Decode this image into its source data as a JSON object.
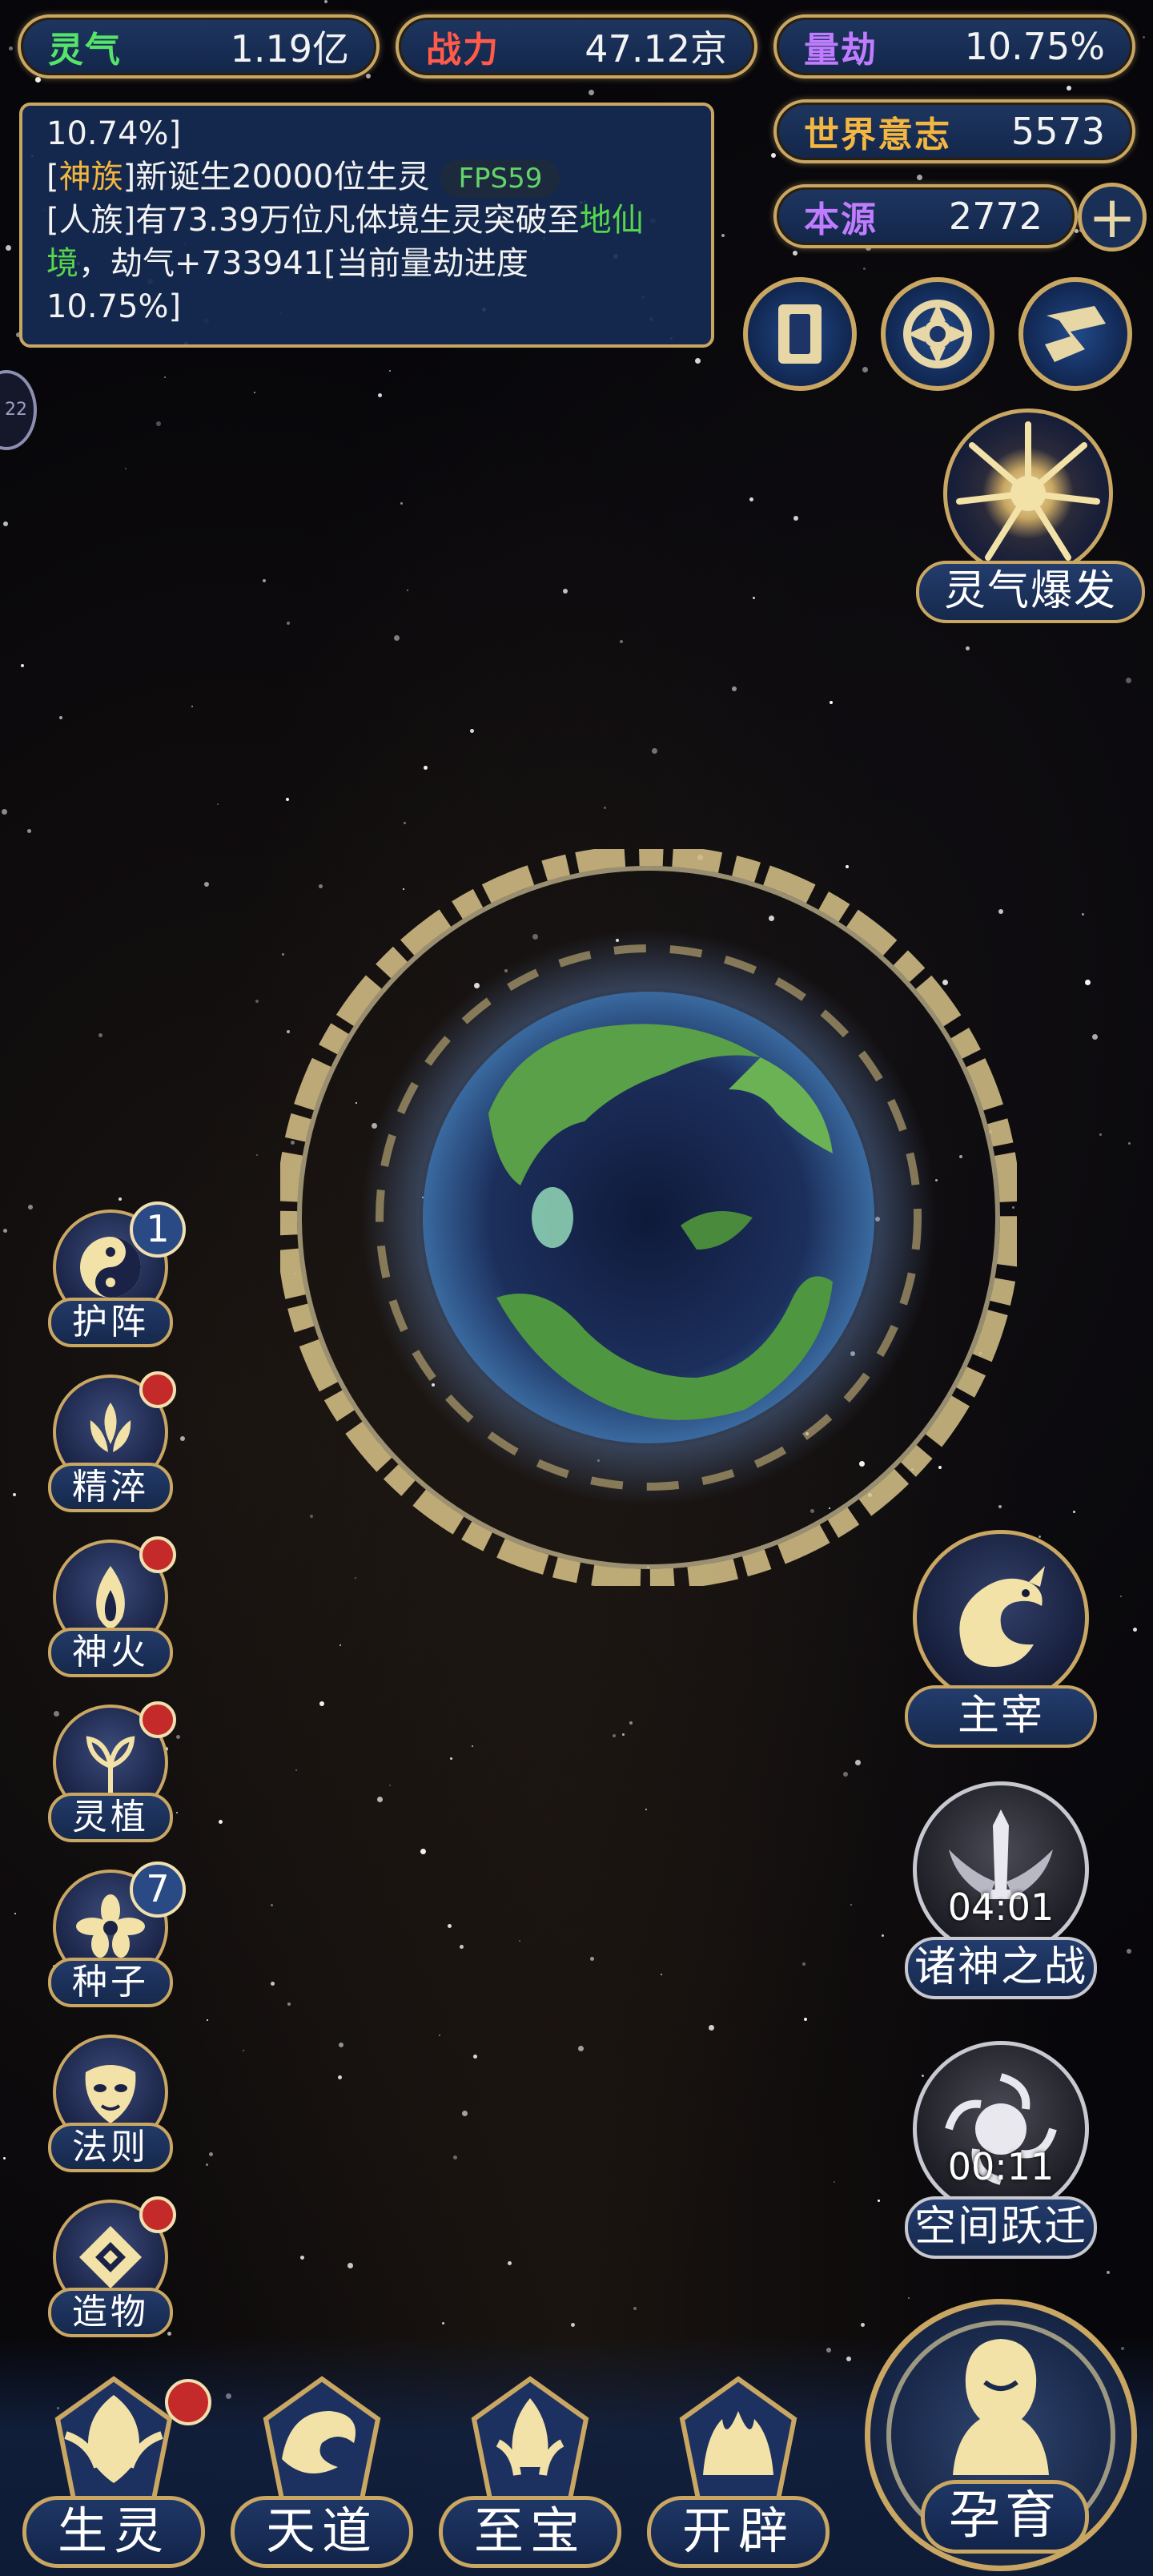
{
  "top_stats": {
    "lingqi": {
      "label": "灵气",
      "value": "1.19亿",
      "color": "#56e36a"
    },
    "zhanli": {
      "label": "战力",
      "value": "47.12京",
      "color": "#ff5a4a"
    },
    "liangjie": {
      "label": "量劫",
      "value": "10.75%",
      "color": "#c07cff"
    },
    "shijie_yizhi": {
      "label": "世界意志",
      "value": "5573",
      "color": "#f3b640"
    },
    "benyuan": {
      "label": "本源",
      "value": "2772",
      "color": "#c07cff"
    }
  },
  "log": {
    "line1": "10.74%]",
    "line2_prefix": "[",
    "line2_race": "神族",
    "line2_text": "]新诞生20000位生灵",
    "fps": "FPS59",
    "line3_text": "[人族]有73.39万位凡体境生灵突破至",
    "line3_green": "地仙境",
    "line3_rest": "，劫气+733941[当前量劫进度",
    "line4": "10.75%]"
  },
  "edge_chip": "22",
  "burst": {
    "label": "灵气爆发"
  },
  "left_menu": [
    {
      "label": "护阵",
      "badge": "1",
      "icon": "yin-yang-icon"
    },
    {
      "label": "精淬",
      "badge": "dot",
      "icon": "lotus-flame-icon"
    },
    {
      "label": "神火",
      "badge": "dot",
      "icon": "flame-icon"
    },
    {
      "label": "灵植",
      "badge": "dot",
      "icon": "plant-icon"
    },
    {
      "label": "种子",
      "badge": "7",
      "icon": "flower-icon"
    },
    {
      "label": "法则",
      "badge": "",
      "icon": "mask-icon"
    },
    {
      "label": "造物",
      "badge": "dot",
      "icon": "diamond-icon"
    }
  ],
  "right_menu": {
    "zhuzai": {
      "label": "主宰"
    },
    "zhushen": {
      "label": "诸神之战",
      "timer": "04:01"
    },
    "kongjian": {
      "label": "空间跃迁",
      "timer": "00:11"
    }
  },
  "bottom_nav": [
    {
      "label": "生灵",
      "badge": "dot"
    },
    {
      "label": "天道",
      "badge": ""
    },
    {
      "label": "至宝",
      "badge": ""
    },
    {
      "label": "开辟",
      "badge": ""
    }
  ],
  "breed": {
    "label": "孕育"
  },
  "colors": {
    "gold": "#c9a763",
    "panel": "#16294d",
    "badge_red": "#c52a2a"
  }
}
